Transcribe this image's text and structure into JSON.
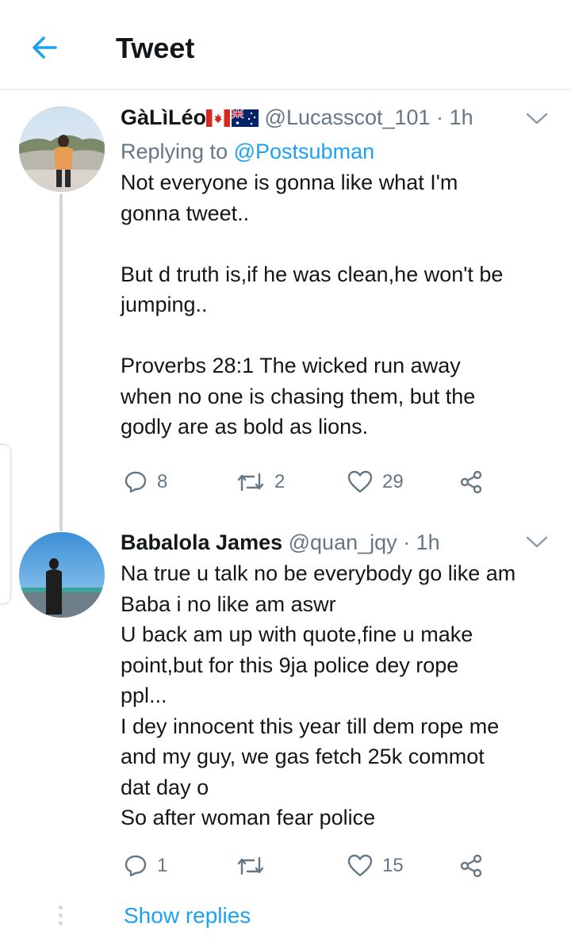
{
  "header": {
    "title": "Tweet",
    "back_icon": "arrow-left-icon"
  },
  "colors": {
    "accent": "#1da1f2",
    "muted": "#657786",
    "text": "#14171a",
    "divider": "#e1e8ed"
  },
  "tweets": [
    {
      "display_name": "GàLìLéo",
      "flags": [
        "canada-flag-icon",
        "australia-flag-icon"
      ],
      "handle": "@Lucasscot_101",
      "time": "· 1h",
      "replying_prefix": "Replying to",
      "replying_to": "@Postsubman",
      "text": "Not everyone is gonna like what I'm\ngonna tweet..\n\nBut d truth is,if he was clean,he won't be\njumping..\n\nProverbs 28:1 The wicked run away\nwhen no one is chasing them, but the\ngodly are as bold as lions.",
      "replies": "8",
      "retweets": "2",
      "likes": "29"
    },
    {
      "display_name": "Babalola James",
      "handle": "@quan_jqy",
      "time": "· 1h",
      "text": "Na true u talk no be everybody go like am\nBaba i no like am aswr\nU back am up with quote,fine u make\npoint,but for this 9ja police dey rope\nppl...\nI dey innocent this year till dem rope me\nand my guy, we gas fetch 25k commot\ndat day o\nSo after woman fear police",
      "replies": "1",
      "retweets": "",
      "likes": "15"
    }
  ],
  "show_replies": "Show replies"
}
